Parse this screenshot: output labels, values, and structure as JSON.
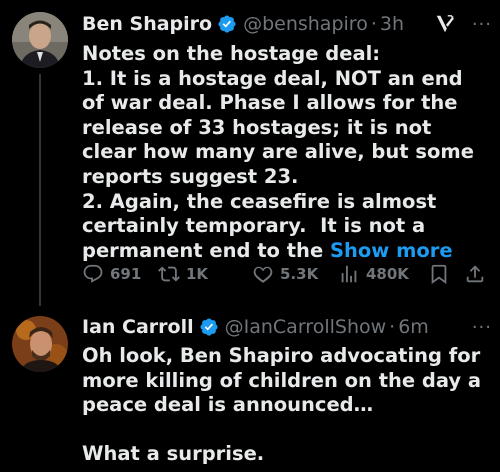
{
  "tweets": [
    {
      "author": {
        "name": "Ben Shapiro",
        "handle": "@benshapiro",
        "time": "3h"
      },
      "text": "Notes on the hostage deal:\n1. It is a hostage deal, NOT an end of war deal. Phase I allows for the release of 33 hostages; it is not clear how many are alive, but some reports suggest 23.\n2. Again, the ceasefire is almost certainly temporary.  It is not a permanent end to the ",
      "show_more": "Show more",
      "stats": {
        "replies": "691",
        "reposts": "1K",
        "likes": "5.3K",
        "views": "480K"
      }
    },
    {
      "author": {
        "name": "Ian Carroll",
        "handle": "@IanCarrollShow",
        "time": "6m"
      },
      "text": "Oh look, Ben Shapiro advocating for more killing of children on the day a peace deal is announced…\n\nWhat a surprise."
    }
  ],
  "separator_dot": "·",
  "more_glyph": "···",
  "colors": {
    "background": "#000000",
    "text": "#e7e9ea",
    "muted": "#71767b",
    "link": "#1d9bf0",
    "verified": "#1d9bf0"
  }
}
